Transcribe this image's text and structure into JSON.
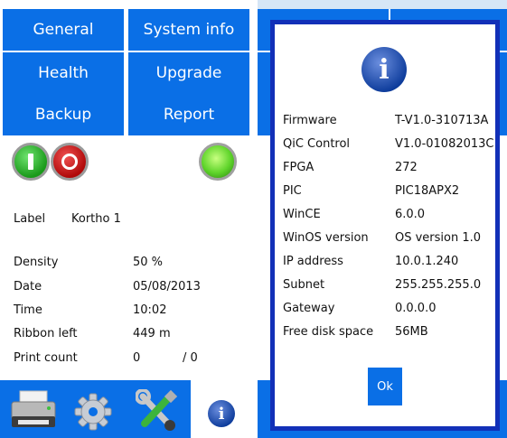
{
  "menu": {
    "general": "General",
    "system_info": "System info",
    "health": "Health",
    "upgrade": "Upgrade",
    "backup": "Backup",
    "report": "Report"
  },
  "status": {
    "label_key": "Label",
    "label_value": "Kortho 1",
    "rows": [
      {
        "key": "Density",
        "value": "50 %"
      },
      {
        "key": "Date",
        "value": "05/08/2013"
      },
      {
        "key": "Time",
        "value": "10:02"
      },
      {
        "key": "Ribbon left",
        "value": "449 m"
      },
      {
        "key": "Print count",
        "value": "0",
        "total": "/ 0"
      }
    ]
  },
  "toolbar_icons": [
    "printer-icon",
    "gear-icon",
    "tools-icon",
    "info-icon"
  ],
  "dialog": {
    "rows": [
      {
        "key": "Firmware",
        "value": "T-V1.0-310713A"
      },
      {
        "key": "QiC Control",
        "value": "V1.0-01082013C"
      },
      {
        "key": "FPGA",
        "value": "272"
      },
      {
        "key": "PIC",
        "value": "PIC18APX2"
      },
      {
        "key": "WinCE",
        "value": "6.0.0"
      },
      {
        "key": "WinOS version",
        "value": "OS version 1.0"
      },
      {
        "key": "IP address",
        "value": "10.0.1.240"
      },
      {
        "key": "Subnet",
        "value": "255.255.255.0"
      },
      {
        "key": "Gateway",
        "value": "0.0.0.0"
      },
      {
        "key": "Free disk space",
        "value": "56MB"
      }
    ],
    "ok_label": "Ok"
  },
  "colors": {
    "accent_blue": "#0a6fe6",
    "dialog_border": "#1230b8",
    "start_green": "#1a9a1a",
    "stop_red": "#b00a0a",
    "led_green": "#5ed42a"
  }
}
